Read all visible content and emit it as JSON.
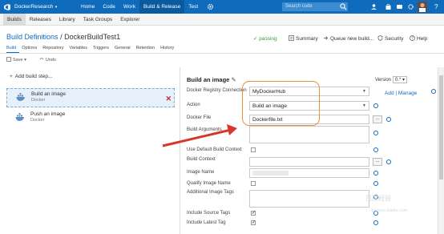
{
  "topbar": {
    "project": "DockerResearch",
    "hubs": [
      "Home",
      "Code",
      "Work",
      "Build & Release",
      "Test"
    ],
    "active_hub": "Build & Release",
    "search_placeholder": "Search code"
  },
  "subnav": {
    "items": [
      "Builds",
      "Releases",
      "Library",
      "Task Groups",
      "Explorer"
    ],
    "active": "Builds"
  },
  "header": {
    "breadcrumb_root": "Build Definitions",
    "separator": "/",
    "definition_name": "DockerBuildTest1",
    "status": "✓ passing",
    "links": {
      "summary": "Summary",
      "queue": "Queue new build...",
      "security": "Security",
      "help": "Help"
    }
  },
  "def_tabs": [
    "Build",
    "Options",
    "Repository",
    "Variables",
    "Triggers",
    "General",
    "Retention",
    "History"
  ],
  "active_def_tab": "Build",
  "toolbar": {
    "save": "Save ▾",
    "undo": "Undo"
  },
  "left": {
    "add_step": "Add build step...",
    "steps": [
      {
        "title": "Build an image",
        "subtitle": "Docker",
        "selected": true
      },
      {
        "title": "Push an image",
        "subtitle": "Docker",
        "selected": false
      }
    ]
  },
  "task": {
    "title": "Build an image",
    "version_label": "Version",
    "version_value": "0.* ▾",
    "add_manage": "Add | Manage",
    "fields": {
      "registry_label": "Docker Registry Connection",
      "registry_value": "MyDockerHub",
      "action_label": "Action",
      "action_value": "Build an image",
      "dockerfile_label": "Docker File",
      "dockerfile_value": "Dockerfile.txt",
      "build_args_label": "Build Arguments",
      "use_default_label": "Use Default Build Context",
      "build_context_label": "Build Context",
      "image_name_label": "Image Name",
      "qualify_label": "Qualify Image Name",
      "additional_tags_label": "Additional Image Tags",
      "include_source_label": "Include Source Tags",
      "include_latest_label": "Include Latest Tag"
    },
    "checks": {
      "use_default": false,
      "qualify": false,
      "include_source": true,
      "include_latest": true
    }
  },
  "colors": {
    "topbar": "#0f6cbd",
    "accent": "#0f6cbd",
    "passing": "#3a9a3a",
    "callout": "#e8913a",
    "arrow": "#d9362b",
    "delete": "#c0262d"
  },
  "icons": [
    "visual-studio-logo",
    "gear-icon",
    "search-icon",
    "user-icon",
    "summary-icon",
    "queue-icon",
    "security-icon",
    "help-icon",
    "docker-whale-icon",
    "pencil-icon",
    "info-icon",
    "delete-icon",
    "undo-icon",
    "save-icon"
  ],
  "watermark": {
    "line1": "百度经验",
    "line2": "jingyan.baidu.com"
  }
}
